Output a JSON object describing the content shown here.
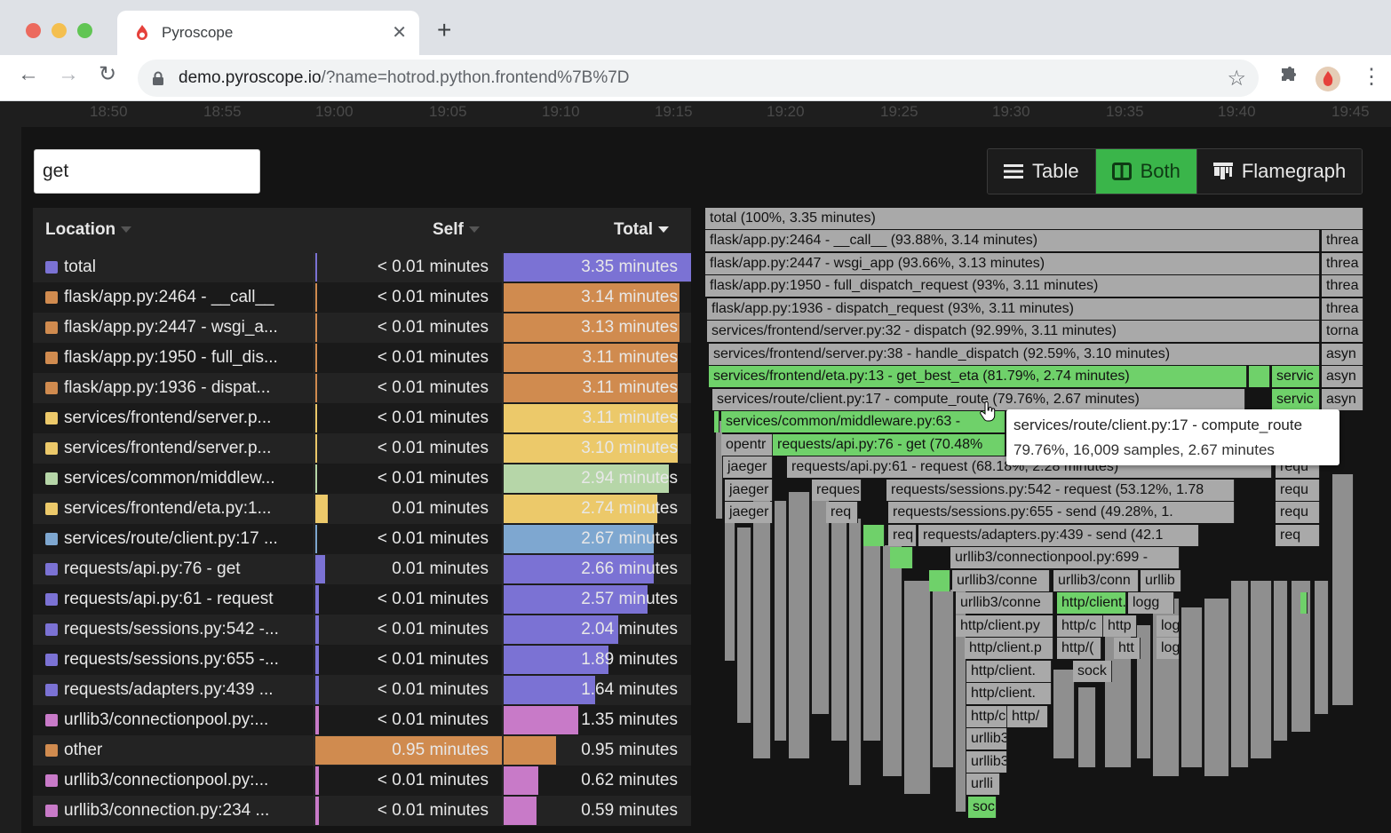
{
  "browser": {
    "tab_title": "Pyroscope",
    "url_host": "demo.pyroscope.io",
    "url_rest": "/?name=hotrod.python.frontend%7B%7D"
  },
  "timeline": {
    "ticks": [
      "18:50",
      "18:55",
      "19:00",
      "19:05",
      "19:10",
      "19:15",
      "19:20",
      "19:25",
      "19:30",
      "19:35",
      "19:40",
      "19:45"
    ]
  },
  "search": {
    "value": "get"
  },
  "view_toggle": {
    "table": "Table",
    "both": "Both",
    "flamegraph": "Flamegraph",
    "active": "both"
  },
  "table": {
    "headers": {
      "location": "Location",
      "self": "Self",
      "total": "Total"
    },
    "rows": [
      {
        "location": "total",
        "self": "< 0.01 minutes",
        "total": "3.35 minutes",
        "color": "#7b72d4",
        "self_frac": 0.0,
        "total_frac": 1.0,
        "self_highlight": false
      },
      {
        "location": "flask/app.py:2464 - __call__",
        "self": "< 0.01 minutes",
        "total": "3.14 minutes",
        "color": "#d08b4f",
        "self_frac": 0.0,
        "total_frac": 0.94,
        "self_highlight": false
      },
      {
        "location": "flask/app.py:2447 - wsgi_a...",
        "self": "< 0.01 minutes",
        "total": "3.13 minutes",
        "color": "#d08b4f",
        "self_frac": 0.0,
        "total_frac": 0.94,
        "self_highlight": false
      },
      {
        "location": "flask/app.py:1950 - full_dis...",
        "self": "< 0.01 minutes",
        "total": "3.11 minutes",
        "color": "#d08b4f",
        "self_frac": 0.0,
        "total_frac": 0.93,
        "self_highlight": false
      },
      {
        "location": "flask/app.py:1936 - dispat...",
        "self": "< 0.01 minutes",
        "total": "3.11 minutes",
        "color": "#d08b4f",
        "self_frac": 0.0,
        "total_frac": 0.93,
        "self_highlight": false
      },
      {
        "location": "services/frontend/server.p...",
        "self": "< 0.01 minutes",
        "total": "3.11 minutes",
        "color": "#ecc96a",
        "self_frac": 0.0,
        "total_frac": 0.93,
        "self_highlight": false
      },
      {
        "location": "services/frontend/server.p...",
        "self": "< 0.01 minutes",
        "total": "3.10 minutes",
        "color": "#ecc96a",
        "self_frac": 0.0,
        "total_frac": 0.93,
        "self_highlight": false
      },
      {
        "location": "services/common/middlew...",
        "self": "< 0.01 minutes",
        "total": "2.94 minutes",
        "color": "#b6d6a8",
        "self_frac": 0.0,
        "total_frac": 0.88,
        "self_highlight": false
      },
      {
        "location": "services/frontend/eta.py:1...",
        "self": "0.01 minutes",
        "total": "2.74 minutes",
        "color": "#ecc96a",
        "self_frac": 0.065,
        "total_frac": 0.82,
        "self_highlight": false
      },
      {
        "location": "services/route/client.py:17 ...",
        "self": "< 0.01 minutes",
        "total": "2.67 minutes",
        "color": "#7ea7d0",
        "self_frac": 0.0,
        "total_frac": 0.8,
        "self_highlight": false
      },
      {
        "location": "requests/api.py:76 - get",
        "self": "0.01 minutes",
        "total": "2.66 minutes",
        "color": "#7b72d4",
        "self_frac": 0.05,
        "total_frac": 0.8,
        "self_highlight": false
      },
      {
        "location": "requests/api.py:61 - request",
        "self": "< 0.01 minutes",
        "total": "2.57 minutes",
        "color": "#7b72d4",
        "self_frac": 0.02,
        "total_frac": 0.77,
        "self_highlight": false
      },
      {
        "location": "requests/sessions.py:542 -...",
        "self": "< 0.01 minutes",
        "total": "2.04 minutes",
        "color": "#7b72d4",
        "self_frac": 0.02,
        "total_frac": 0.61,
        "self_highlight": false
      },
      {
        "location": "requests/sessions.py:655 -...",
        "self": "< 0.01 minutes",
        "total": "1.89 minutes",
        "color": "#7b72d4",
        "self_frac": 0.02,
        "total_frac": 0.56,
        "self_highlight": false
      },
      {
        "location": "requests/adapters.py:439 ...",
        "self": "< 0.01 minutes",
        "total": "1.64 minutes",
        "color": "#7b72d4",
        "self_frac": 0.02,
        "total_frac": 0.49,
        "self_highlight": false
      },
      {
        "location": "urllib3/connectionpool.py:...",
        "self": "< 0.01 minutes",
        "total": "1.35 minutes",
        "color": "#c87ac8",
        "self_frac": 0.02,
        "total_frac": 0.4,
        "self_highlight": false
      },
      {
        "location": "other",
        "self": "0.95 minutes",
        "total": "0.95 minutes",
        "color": "#d08b4f",
        "self_frac": 1.0,
        "total_frac": 0.28,
        "self_highlight": true
      },
      {
        "location": "urllib3/connectionpool.py:...",
        "self": "< 0.01 minutes",
        "total": "0.62 minutes",
        "color": "#c87ac8",
        "self_frac": 0.02,
        "total_frac": 0.185,
        "self_highlight": false
      },
      {
        "location": "urllib3/connection.py:234 ...",
        "self": "< 0.01 minutes",
        "total": "0.59 minutes",
        "color": "#c87ac8",
        "self_frac": 0.02,
        "total_frac": 0.175,
        "self_highlight": false
      }
    ]
  },
  "flamegraph": {
    "labels": {
      "total": "total (100%, 3.35 minutes)",
      "call": "flask/app.py:2464 - __call__ (93.88%, 3.14 minutes)",
      "wsgi": "flask/app.py:2447 - wsgi_app (93.66%, 3.13 minutes)",
      "full_dispatch": "flask/app.py:1950 - full_dispatch_request (93%, 3.11 minutes)",
      "dispatch_request": "flask/app.py:1936 - dispatch_request (93%, 3.11 minutes)",
      "server32": "services/frontend/server.py:32 - dispatch (92.99%, 3.11 minutes)",
      "server38": "services/frontend/server.py:38 - handle_dispatch (92.59%, 3.10 minutes)",
      "eta": "services/frontend/eta.py:13 - get_best_eta (81.79%, 2.74 minutes)",
      "route": "services/route/client.py:17 - compute_route (79.76%, 2.67 minutes)",
      "middleware": "services/common/middleware.py:63 -",
      "api76": "requests/api.py:76 - get (70.48%",
      "api61": "requests/api.py:61 - request (68.18%, 2.28 minutes)",
      "sess542": "requests/sessions.py:542 - request (53.12%, 1.78",
      "sess655": "requests/sessions.py:655 - send (49.28%, 1.",
      "adapters": "requests/adapters.py:439 - send (42.1",
      "connpool699": "urllib3/connectionpool.py:699 -",
      "threa": "threa",
      "torna": "torna",
      "asyn": "asyn",
      "servic": "servic",
      "opentr": "opentr",
      "jaeger": "jaeger",
      "reques": "reques",
      "req": "req",
      "requ": "requ",
      "urllib3_conne": "urllib3/conne",
      "urllib3_conn": "urllib3/conn",
      "urllib": "urllib",
      "http_client": "http/client.",
      "logg": "logg",
      "http_client_py": "http/client.py",
      "http_c": "http/c",
      "http": "http",
      "log": "log",
      "http_client_p": "http/client.p",
      "http_cl": "http/(",
      "htt": "htt",
      "http_client_dot": "http/client.",
      "sock": "sock",
      "http_client2": "http/client.",
      "http_c2": "http/c",
      "http_slash": "http/",
      "urllib3_a": "urllib3",
      "urllib3_b": "urllib3",
      "urlli": "urlli",
      "soc": "soc"
    },
    "tooltip": {
      "title": "services/route/client.py:17 - compute_route",
      "detail": "79.76%, 16,009 samples, 2.67 minutes"
    }
  },
  "colors": {
    "accent": "#3ab54a",
    "flame_green": "#6fd16a",
    "flame_grey": "#a9a9a9"
  }
}
